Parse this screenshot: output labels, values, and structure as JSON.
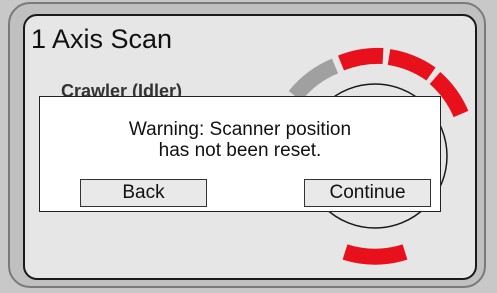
{
  "screen": {
    "title": "1 Axis Scan",
    "crawler_label": "Crawler (Idler)"
  },
  "gauge": {
    "segment_colors": [
      "#a0a0a0",
      "#e8101a",
      "#e8101a",
      "#e8101a"
    ],
    "ring_color": "#1a1a1a"
  },
  "dialog": {
    "message_line1": "Warning: Scanner position",
    "message_line2": "has not been reset.",
    "back_label": "Back",
    "continue_label": "Continue"
  }
}
